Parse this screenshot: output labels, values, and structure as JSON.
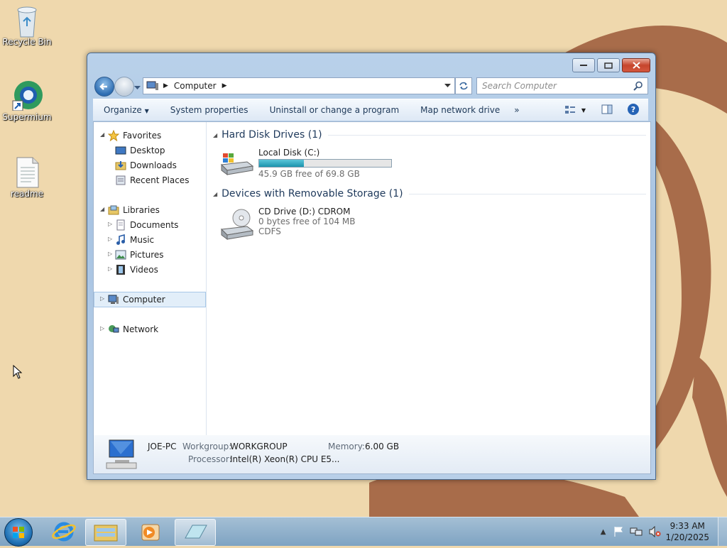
{
  "desktop": {
    "icons": [
      {
        "label": "Recycle Bin"
      },
      {
        "label": "Supermium"
      },
      {
        "label": "readme"
      }
    ]
  },
  "window": {
    "address": {
      "location": "Computer"
    },
    "search": {
      "placeholder": "Search Computer"
    },
    "toolbar": {
      "organize": "Organize",
      "system_properties": "System properties",
      "uninstall": "Uninstall or change a program",
      "map_drive": "Map network drive",
      "more": "»"
    },
    "nav": {
      "favorites": "Favorites",
      "desktop": "Desktop",
      "downloads": "Downloads",
      "recent_places": "Recent Places",
      "libraries": "Libraries",
      "documents": "Documents",
      "music": "Music",
      "pictures": "Pictures",
      "videos": "Videos",
      "computer": "Computer",
      "network": "Network"
    },
    "groups": {
      "hard_disk": {
        "title": "Hard Disk Drives (1)",
        "drives": [
          {
            "name": "Local Disk (C:)",
            "free": "45.9 GB free of 69.8 GB",
            "used_fraction": 0.34
          }
        ]
      },
      "removable": {
        "title": "Devices with Removable Storage (1)",
        "drives": [
          {
            "name": "CD Drive (D:) CDROM",
            "free": "0 bytes free of 104 MB",
            "fs": "CDFS"
          }
        ]
      }
    },
    "details": {
      "computer_name": "JOE-PC",
      "workgroup_label": "Workgroup:",
      "workgroup": "WORKGROUP",
      "memory_label": "Memory:",
      "memory": "6.00 GB",
      "processor_label": "Processor:",
      "processor": "Intel(R) Xeon(R) CPU E5..."
    }
  },
  "taskbar": {
    "clock_time": "9:33 AM",
    "clock_date": "1/20/2025"
  },
  "colors": {
    "wallpaper": "#efd8ad",
    "accent_brown": "#a86c4a",
    "drive_bar": "#1b94ad"
  }
}
